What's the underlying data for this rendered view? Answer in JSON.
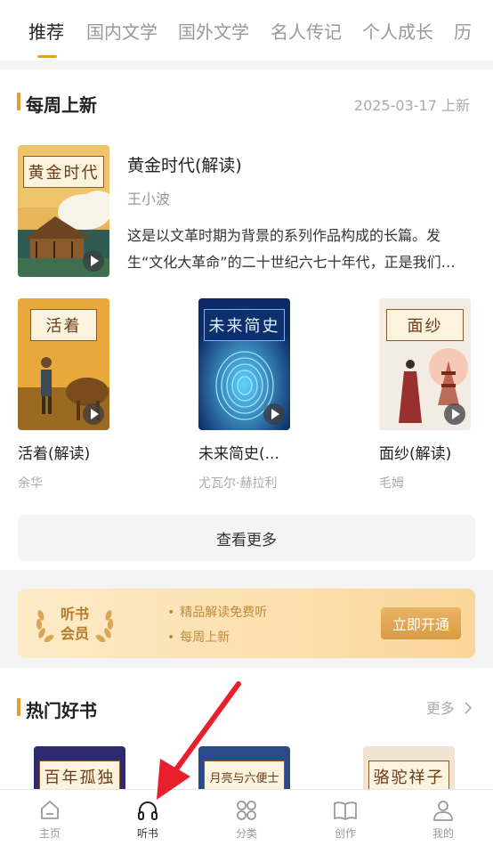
{
  "tabs": [
    {
      "label": "推荐",
      "active": true
    },
    {
      "label": "国内文学"
    },
    {
      "label": "国外文学"
    },
    {
      "label": "名人传记"
    },
    {
      "label": "个人成长"
    },
    {
      "label": "历"
    }
  ],
  "weekly": {
    "title": "每周上新",
    "date": "2025-03-17 上新",
    "featured": {
      "cover_text": "黄金时代",
      "title": "黄金时代(解读)",
      "author": "王小波",
      "description": "这是以文革时期为背景的系列作品构成的长篇。发生“文化大革命”的二十世纪六七十年代，正是我们…"
    },
    "books": [
      {
        "cover_text": "活着",
        "title": "活着(解读)",
        "author": "余华"
      },
      {
        "cover_text": "未来简史",
        "title": "未来简史(...",
        "author": "尤瓦尔·赫拉利"
      },
      {
        "cover_text": "面纱",
        "title": "面纱(解读)",
        "author": "毛姆"
      }
    ],
    "more_button": "查看更多"
  },
  "member": {
    "title_line1": "听书",
    "title_line2": "会员",
    "benefits": [
      "精品解读免费听",
      "每周上新"
    ],
    "button": "立即开通"
  },
  "hot": {
    "title": "热门好书",
    "more": "更多",
    "covers": [
      "百年孤独",
      "月亮与六便士",
      "骆驼祥子"
    ]
  },
  "bottom_nav": [
    {
      "label": "主页",
      "icon": "home-icon"
    },
    {
      "label": "听书",
      "icon": "headphones-icon",
      "active": true
    },
    {
      "label": "分类",
      "icon": "category-icon"
    },
    {
      "label": "创作",
      "icon": "book-icon"
    },
    {
      "label": "我的",
      "icon": "profile-icon"
    }
  ],
  "colors": {
    "accent": "#e0a030",
    "member_gradient_start": "#fdebc8",
    "member_gradient_end": "#fbd69a",
    "arrow": "#e8202a"
  }
}
